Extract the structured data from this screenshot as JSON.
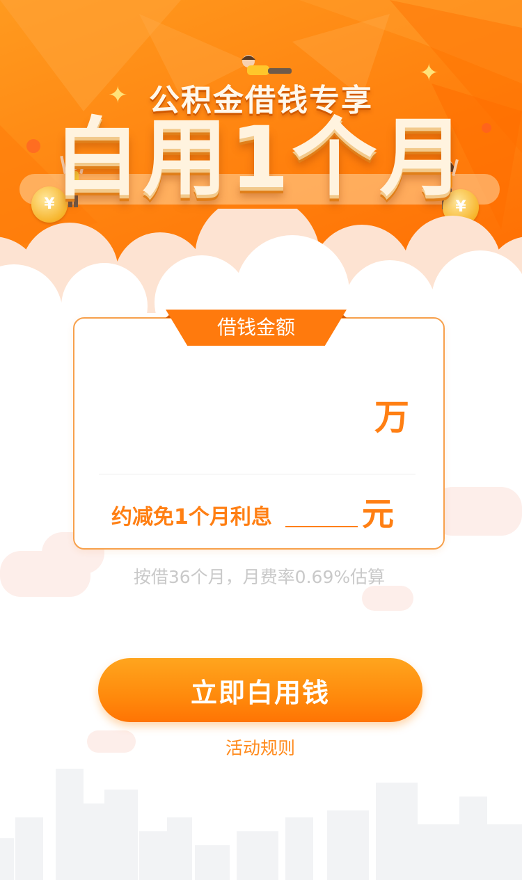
{
  "banner": {
    "subtitle": "公积金借钱专享",
    "headline": "白用1个月",
    "coin_symbol": "¥"
  },
  "card": {
    "tab_label": "借钱金额",
    "amount_value": "",
    "amount_unit": "万",
    "interest_label": "约减免1个月利息",
    "interest_value": "",
    "interest_unit": "元"
  },
  "note": "按借36个月，月费率0.69%估算",
  "cta_label": "立即白用钱",
  "rules_link": "活动规则",
  "colors": {
    "brand_orange": "#ff7f13",
    "banner_orange": "#ff8410",
    "note_gray": "#c9c9c9"
  }
}
